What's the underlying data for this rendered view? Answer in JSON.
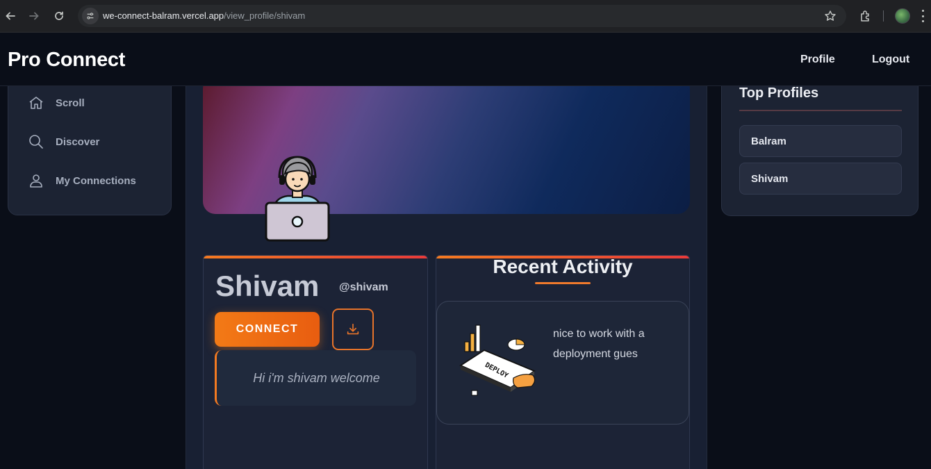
{
  "browser": {
    "url_host": "we-connect-balram.vercel.app",
    "url_path": "/view_profile/shivam"
  },
  "header": {
    "brand": "Pro Connect",
    "nav": [
      "Profile",
      "Logout"
    ]
  },
  "sidebar": {
    "items": [
      {
        "label": "Scroll",
        "icon": "home-icon"
      },
      {
        "label": "Discover",
        "icon": "search-icon"
      },
      {
        "label": "My Connections",
        "icon": "user-icon"
      }
    ]
  },
  "profile": {
    "name": "Shivam",
    "handle": "@shivam",
    "connect_label": "CONNECT",
    "bio": "Hi i'm shivam welcome"
  },
  "activity": {
    "title": "Recent Activity",
    "posts": [
      {
        "text": "nice to work with a deployment gues",
        "image_label": "DEPLOY"
      }
    ]
  },
  "top_profiles": {
    "title": "Top Profiles",
    "items": [
      "Balram",
      "Shivam"
    ]
  },
  "colors": {
    "accent": "#f37a21",
    "background": "#0a0e18",
    "card": "#1c2333"
  }
}
